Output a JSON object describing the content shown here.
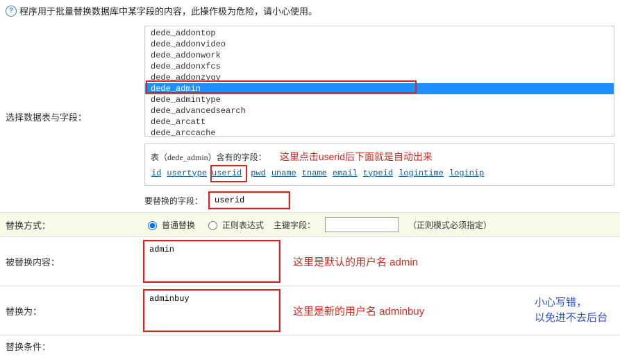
{
  "warning": "程序用于批量替换数据库中某字段的内容，此操作极为危险，请小心使用。",
  "labels": {
    "select_table": "选择数据表与字段：",
    "replace_mode": "替换方式：",
    "replaced_content": "被替换内容：",
    "replace_to": "替换为：",
    "replace_cond": "替换条件："
  },
  "table_list": {
    "items": [
      "dede_addontop",
      "dede_addonvideo",
      "dede_addonwork",
      "dede_addonxfcs",
      "dede_addonzygy",
      "dede_admin",
      "dede_admintype",
      "dede_advancedsearch",
      "dede_arcatt",
      "dede_arccache"
    ],
    "selected_index": 5
  },
  "fields_block": {
    "header_prefix": "表（dede_admin）含有的字段：",
    "annotation": "这里点击userid后下面就是自动出来",
    "fields": [
      "id",
      "usertype",
      "userid",
      "pwd",
      "uname",
      "tname",
      "email",
      "typeid",
      "logintime",
      "loginip"
    ],
    "highlight_field": "userid"
  },
  "replace_field": {
    "label": "要替换的字段：",
    "value": "userid"
  },
  "mode": {
    "normal_label": "普通替换",
    "regex_label": "正则表达式",
    "pk_label": "主键字段：",
    "pk_value": "",
    "note": "（正则模式必须指定）",
    "selected": "normal"
  },
  "content_from": {
    "value": "admin",
    "annotation": "这里是默认的用户名 admin"
  },
  "content_to": {
    "value": "adminbuy",
    "annotation": "这里是新的用户名 adminbuy",
    "right_note_line1": "小心写错，",
    "right_note_line2": "以免进不去后台"
  }
}
